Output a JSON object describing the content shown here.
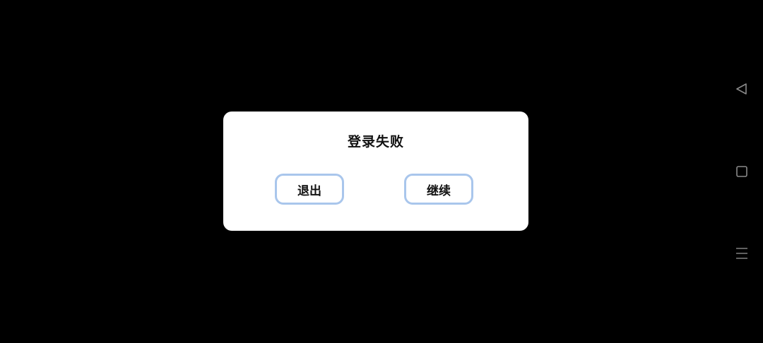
{
  "dialog": {
    "title": "登录失败",
    "exit_label": "退出",
    "continue_label": "继续"
  },
  "nav_bar": {
    "back_icon": "back-triangle-icon",
    "home_icon": "home-square-icon",
    "menu_icon": "menu-lines-icon"
  },
  "colors": {
    "background": "#000000",
    "dialog": "#ffffff",
    "button_border": "#a9c6ec",
    "nav_icon": "#8a8a8a"
  }
}
